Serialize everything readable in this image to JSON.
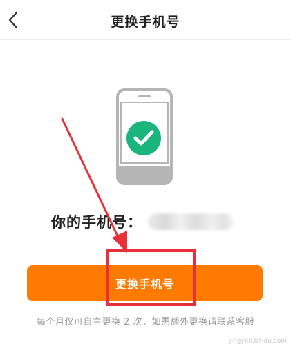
{
  "navbar": {
    "title": "更换手机号",
    "back_icon": "chevron-left-icon"
  },
  "illustration": {
    "icon": "phone-check-icon",
    "phone_color": "#b5b5b5",
    "check_color": "#19b57a"
  },
  "phone_info": {
    "label": "你的手机号："
  },
  "action": {
    "button_label": "更换手机号",
    "button_color": "#ff7a00"
  },
  "hint": {
    "text": "每个月仅可自主更换 2 次，如需额外更换请联系客服"
  },
  "annotation": {
    "highlight_color": "#e8303a",
    "arrow_color": "#e8303a"
  },
  "watermark": {
    "text": "jingyan.baidu.com"
  }
}
